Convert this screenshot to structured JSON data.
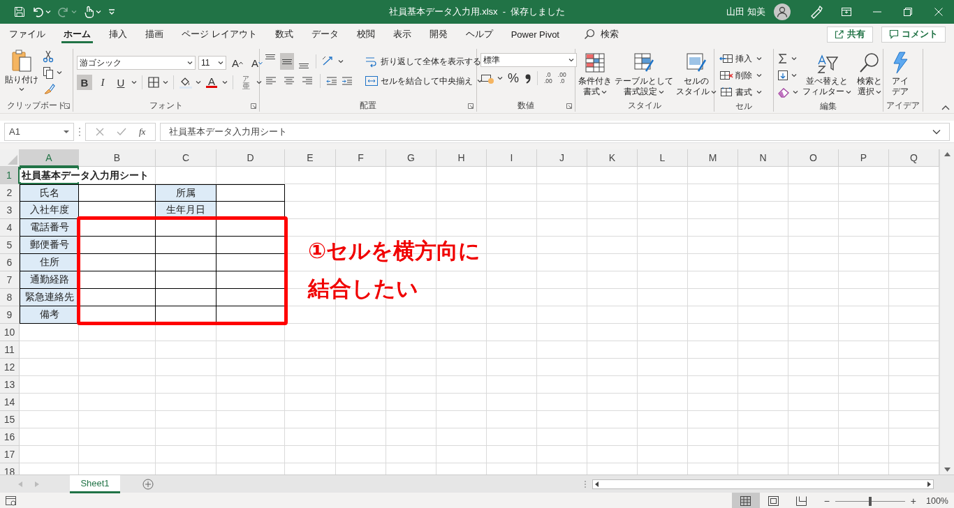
{
  "title_bar": {
    "quick_access": [
      {
        "kind": "save",
        "disabled": false
      },
      {
        "kind": "undo",
        "disabled": false
      },
      {
        "kind": "redo",
        "disabled": true
      },
      {
        "kind": "touch",
        "disabled": false
      },
      {
        "kind": "customize",
        "disabled": false
      }
    ],
    "title": "社員基本データ入力用.xlsx  -  保存しました",
    "user": "山田 知美"
  },
  "ribbon_tabs": [
    {
      "label": "ファイル",
      "selected": false
    },
    {
      "label": "ホーム",
      "selected": true
    },
    {
      "label": "挿入",
      "selected": false
    },
    {
      "label": "描画",
      "selected": false
    },
    {
      "label": "ページ レイアウト",
      "selected": false
    },
    {
      "label": "数式",
      "selected": false
    },
    {
      "label": "データ",
      "selected": false
    },
    {
      "label": "校閲",
      "selected": false
    },
    {
      "label": "表示",
      "selected": false
    },
    {
      "label": "開発",
      "selected": false
    },
    {
      "label": "ヘルプ",
      "selected": false
    },
    {
      "label": "Power Pivot",
      "selected": false
    }
  ],
  "search": {
    "label": "検索"
  },
  "share_button": "共有",
  "comment_button": "コメント",
  "ribbon_groups": [
    {
      "kind": "clipboard",
      "label": "クリップボード",
      "paste": "貼り付け"
    },
    {
      "kind": "font",
      "label": "フォント",
      "font_name": "游ゴシック",
      "font_size": "11",
      "grow": "A",
      "shrink": "A",
      "bold": {
        "text": "B",
        "on": true
      },
      "italic": {
        "text": "I",
        "on": false
      },
      "underline": {
        "text": "U",
        "on": false
      },
      "font_color": "A",
      "phonetic_top": "ア",
      "phonetic": "亜"
    },
    {
      "kind": "alignment",
      "label": "配置",
      "vertical": [
        {
          "kind": "top",
          "selected": false
        },
        {
          "kind": "middle",
          "selected": true
        },
        {
          "kind": "bottom",
          "selected": false
        }
      ],
      "horizontal": [
        {
          "kind": "left",
          "selected": false
        },
        {
          "kind": "center",
          "selected": false
        },
        {
          "kind": "right",
          "selected": false
        }
      ],
      "wrap_text": "折り返して全体を表示する",
      "merge": "セルを結合して中央揃え"
    },
    {
      "kind": "number",
      "label": "数値",
      "format": "標準",
      "percent": "%",
      "increase_decimal": [
        ".0",
        ".00"
      ],
      "decrease_decimal": [
        ".00",
        ".0"
      ]
    },
    {
      "kind": "styles",
      "label": "スタイル",
      "buttons": [
        {
          "kind": "conditional",
          "lines": [
            "条件付き",
            "書式"
          ]
        },
        {
          "kind": "table",
          "lines": [
            "テーブルとして",
            "書式設定"
          ]
        },
        {
          "kind": "cell_styles",
          "lines": [
            "セルの",
            "スタイル"
          ]
        }
      ]
    },
    {
      "kind": "cells",
      "label": "セル",
      "buttons": [
        {
          "kind": "insert",
          "label": "挿入"
        },
        {
          "kind": "delete",
          "label": "削除"
        },
        {
          "kind": "format",
          "label": "書式"
        }
      ]
    },
    {
      "kind": "editing",
      "label": "編集",
      "buttons": [
        {
          "kind": "sort",
          "lines": [
            "並べ替えと",
            "フィルター"
          ]
        },
        {
          "kind": "find",
          "lines": [
            "検索と",
            "選択"
          ]
        }
      ]
    },
    {
      "kind": "ideas",
      "label": "アイデア",
      "button": [
        "アイ",
        "デア"
      ]
    }
  ],
  "formula_bar": {
    "name_box": "A1",
    "function_label": "fx",
    "formula": "社員基本データ入力用シート"
  },
  "sheet": {
    "columns": [
      {
        "label": "A",
        "selected": true
      },
      {
        "label": "B",
        "selected": false
      },
      {
        "label": "C",
        "selected": false
      },
      {
        "label": "D",
        "selected": false
      },
      {
        "label": "E",
        "selected": false
      },
      {
        "label": "F",
        "selected": false
      },
      {
        "label": "G",
        "selected": false
      },
      {
        "label": "H",
        "selected": false
      },
      {
        "label": "I",
        "selected": false
      },
      {
        "label": "J",
        "selected": false
      },
      {
        "label": "K",
        "selected": false
      },
      {
        "label": "L",
        "selected": false
      },
      {
        "label": "M",
        "selected": false
      },
      {
        "label": "N",
        "selected": false
      },
      {
        "label": "O",
        "selected": false
      },
      {
        "label": "P",
        "selected": false
      },
      {
        "label": "Q",
        "selected": false
      }
    ],
    "rows": [
      {
        "label": "1",
        "selected": true,
        "cells": [
          {
            "kind": "title",
            "text": "社員基本データ入力用シート"
          }
        ]
      },
      {
        "label": "2",
        "selected": false,
        "cells": [
          {
            "kind": "label",
            "text": "氏名"
          },
          {
            "kind": "input"
          },
          {
            "kind": "label",
            "text": "所属"
          },
          {
            "kind": "input"
          }
        ]
      },
      {
        "label": "3",
        "selected": false,
        "cells": [
          {
            "kind": "label",
            "text": "入社年度"
          },
          {
            "kind": "input"
          },
          {
            "kind": "label",
            "text": "生年月日"
          },
          {
            "kind": "input"
          }
        ]
      },
      {
        "label": "4",
        "selected": false,
        "cells": [
          {
            "kind": "label",
            "text": "電話番号"
          },
          {
            "kind": "input"
          },
          {
            "kind": "input"
          },
          {
            "kind": "input"
          }
        ]
      },
      {
        "label": "5",
        "selected": false,
        "cells": [
          {
            "kind": "label",
            "text": "郵便番号"
          },
          {
            "kind": "input"
          },
          {
            "kind": "input"
          },
          {
            "kind": "input"
          }
        ]
      },
      {
        "label": "6",
        "selected": false,
        "cells": [
          {
            "kind": "label",
            "text": "住所"
          },
          {
            "kind": "input"
          },
          {
            "kind": "input"
          },
          {
            "kind": "input"
          }
        ]
      },
      {
        "label": "7",
        "selected": false,
        "cells": [
          {
            "kind": "label",
            "text": "通勤経路"
          },
          {
            "kind": "input"
          },
          {
            "kind": "input"
          },
          {
            "kind": "input"
          }
        ]
      },
      {
        "label": "8",
        "selected": false,
        "cells": [
          {
            "kind": "label",
            "text": "緊急連絡先"
          },
          {
            "kind": "input"
          },
          {
            "kind": "input"
          },
          {
            "kind": "input"
          }
        ]
      },
      {
        "label": "9",
        "selected": false,
        "cells": [
          {
            "kind": "label",
            "text": "備考"
          },
          {
            "kind": "input"
          },
          {
            "kind": "input"
          },
          {
            "kind": "input"
          }
        ]
      },
      {
        "label": "10",
        "selected": false
      },
      {
        "label": "11",
        "selected": false
      },
      {
        "label": "12",
        "selected": false
      },
      {
        "label": "13",
        "selected": false
      },
      {
        "label": "14",
        "selected": false
      },
      {
        "label": "15",
        "selected": false
      },
      {
        "label": "16",
        "selected": false
      },
      {
        "label": "17",
        "selected": false
      },
      {
        "label": "18",
        "selected": false
      }
    ]
  },
  "annotation": {
    "lines": [
      "①セルを横方向に",
      "結合したい"
    ]
  },
  "sheet_tabs": [
    {
      "label": "Sheet1",
      "selected": true
    }
  ],
  "status_bar": {
    "views": [
      {
        "kind": "normal",
        "selected": true
      },
      {
        "kind": "page_layout",
        "selected": false
      },
      {
        "kind": "page_break",
        "selected": false
      }
    ],
    "zoom_out": "−",
    "zoom_slider": {
      "level": 0.5
    },
    "zoom_in": "+",
    "zoom": "100%"
  }
}
